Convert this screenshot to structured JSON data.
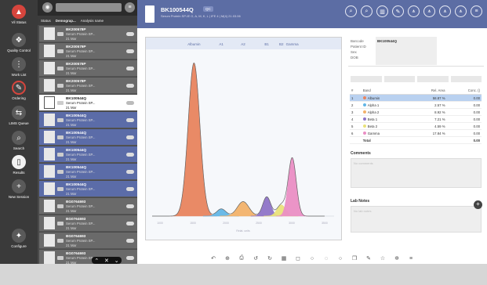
{
  "nav": {
    "items": [
      {
        "label": "Vil Status",
        "icon": "alert-icon",
        "glyph": "▲"
      },
      {
        "label": "Quality Control",
        "icon": "quality-control-icon",
        "glyph": "❖"
      },
      {
        "label": "Work List",
        "icon": "work-list-icon",
        "glyph": "⋮"
      },
      {
        "label": "Ordering",
        "icon": "ordering-icon",
        "glyph": "✎"
      },
      {
        "label": "LIMS Queue",
        "icon": "lims-queue-icon",
        "glyph": "⇆"
      },
      {
        "label": "Search",
        "icon": "search-icon",
        "glyph": "⌕"
      },
      {
        "label": "Results",
        "icon": "results-icon",
        "glyph": "▯"
      },
      {
        "label": "New Session",
        "icon": "plus-icon",
        "glyph": "+"
      },
      {
        "label": "Configure",
        "icon": "wrench-icon",
        "glyph": "✦"
      }
    ]
  },
  "list": {
    "headers": [
      "Status",
      "Demograp...",
      "Analysis name"
    ],
    "rows": [
      {
        "barcode": "BK200578P",
        "analysis": "Serum Protein SP...",
        "sub": "21 Mar",
        "state": "grey"
      },
      {
        "barcode": "BK200579P",
        "analysis": "Serum Protein SP...",
        "sub": "21 Mar",
        "state": "grey"
      },
      {
        "barcode": "BK200576P",
        "analysis": "Serum Protein SP...",
        "sub": "21 Mar",
        "state": "grey"
      },
      {
        "barcode": "BK200578P",
        "analysis": "Serum Protein SP...",
        "sub": "21 Mar",
        "state": "grey"
      },
      {
        "barcode": "BK100544Q",
        "analysis": "Serum Protein SP...",
        "sub": "21 Mar",
        "state": "sel"
      },
      {
        "barcode": "BK100544Q",
        "analysis": "Serum Protein SP...",
        "sub": "21 Mar",
        "state": "blue"
      },
      {
        "barcode": "BK100544Q",
        "analysis": "Serum Protein SP...",
        "sub": "21 Mar",
        "state": "blue"
      },
      {
        "barcode": "BK100544Q",
        "analysis": "Serum Protein SP...",
        "sub": "21 Mar",
        "state": "blue"
      },
      {
        "barcode": "BK100544Q",
        "analysis": "Serum Protein SP...",
        "sub": "21 Mar",
        "state": "blue"
      },
      {
        "barcode": "BK100544Q",
        "analysis": "Serum Protein SP...",
        "sub": "21 Mar",
        "state": "blue"
      },
      {
        "barcode": "BG0764693",
        "analysis": "Serum Protein SP...",
        "sub": "21 Mar",
        "state": "grey"
      },
      {
        "barcode": "BG0764693",
        "analysis": "Serum Protein SP...",
        "sub": "21 Mar",
        "state": "grey"
      },
      {
        "barcode": "BG0764693",
        "analysis": "Serum Protein SP...",
        "sub": "21 Mar",
        "state": "grey"
      },
      {
        "barcode": "BG0764693",
        "analysis": "Serum Protein SP...",
        "sub": "21 Mar",
        "state": "grey"
      }
    ]
  },
  "header": {
    "sample_id": "BK100544Q",
    "badge": "QC",
    "subtitle": "Serum Protein SP-IE G, A, M, K, L | IFE 4 | M(4) 21.03.06"
  },
  "chart": {
    "band_labels": [
      "Albumin",
      "A1",
      "A2",
      "B1",
      "B2",
      "Gamma"
    ],
    "x_label": "Relat. units",
    "x_ticks": [
      "1000",
      "1500",
      "2000",
      "2500",
      "3000",
      "3500"
    ]
  },
  "chart_data": {
    "type": "line",
    "title": "",
    "xlabel": "Relat. units",
    "ylabel": "",
    "xlim": [
      0,
      100
    ],
    "ylim": [
      0,
      1
    ],
    "series": [
      {
        "name": "Albumin",
        "color": "#e8845e",
        "peak_x": 23,
        "peak_y": 0.95
      },
      {
        "name": "Alpha 1",
        "color": "#63b6e6",
        "peak_x": 38,
        "peak_y": 0.045
      },
      {
        "name": "Alpha 2",
        "color": "#f2b26a",
        "peak_x": 50,
        "peak_y": 0.09
      },
      {
        "name": "Beta 1",
        "color": "#8e74c7",
        "peak_x": 63,
        "peak_y": 0.12
      },
      {
        "name": "Beta 2",
        "color": "#e9e27a",
        "peak_x": 71,
        "peak_y": 0.07
      },
      {
        "name": "Gamma",
        "color": "#ea8ec4",
        "peak_x": 77,
        "peak_y": 0.36
      }
    ]
  },
  "details": {
    "labels": [
      "Barcode",
      "Patient ID",
      "Sex",
      "DOB"
    ],
    "barcode_value": "BK100544Q",
    "seg_tabs": [
      "",
      "",
      "",
      ""
    ],
    "band_headers": [
      "#",
      "Band",
      "Rel. Area",
      "Conc. ()"
    ],
    "bands": [
      {
        "n": "1",
        "name": "Albumin",
        "rel": "58.87 %",
        "conc": "0.00",
        "color": "#e8845e"
      },
      {
        "n": "2",
        "name": "Alpha 1",
        "rel": "2.57 %",
        "conc": "0.00",
        "color": "#63b6e6"
      },
      {
        "n": "3",
        "name": "Alpha 2",
        "rel": "8.92 %",
        "conc": "0.00",
        "color": "#f2b26a"
      },
      {
        "n": "4",
        "name": "Beta 1",
        "rel": "7.21 %",
        "conc": "0.00",
        "color": "#8e74c7"
      },
      {
        "n": "5",
        "name": "Beta 2",
        "rel": "4.59 %",
        "conc": "0.00",
        "color": "#e9e27a"
      },
      {
        "n": "6",
        "name": "Gamma",
        "rel": "17.84 %",
        "conc": "0.00",
        "color": "#ea8ec4"
      }
    ],
    "total_label": "Total",
    "total_conc": "0.00",
    "comments_title": "Comments",
    "comments_placeholder": "No comments",
    "lab_notes_title": "Lab Notes",
    "lab_notes_placeholder": "No lab notes"
  }
}
